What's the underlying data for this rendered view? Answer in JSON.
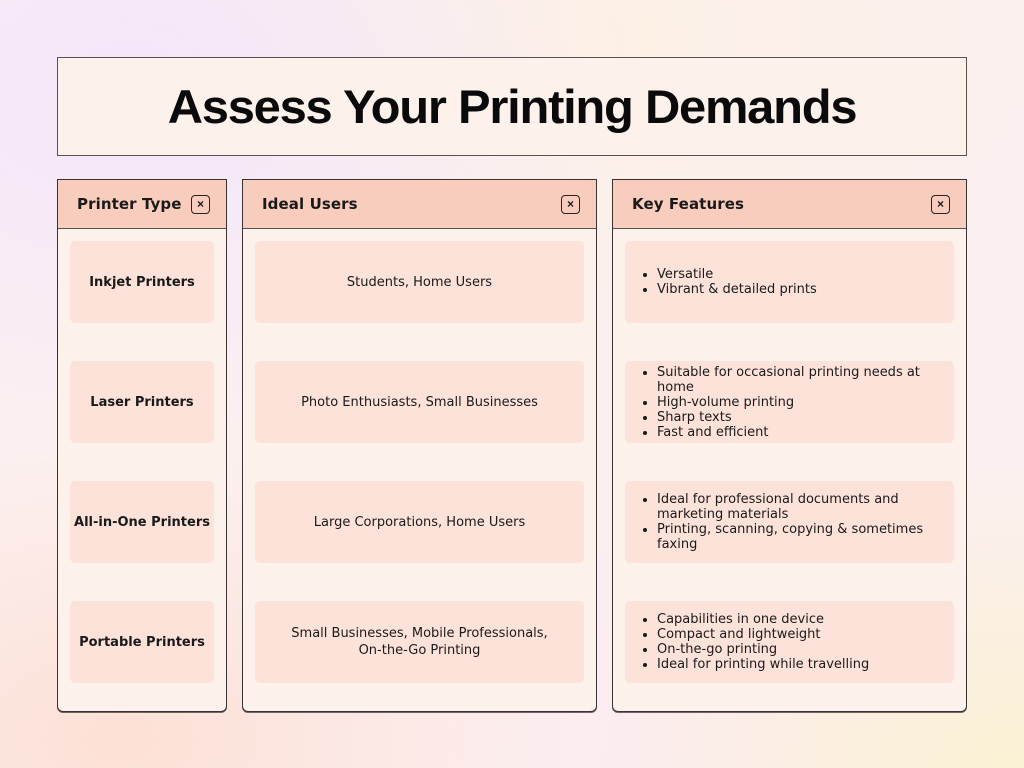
{
  "title": "Assess Your Printing Demands",
  "close_glyph": "×",
  "columns": [
    {
      "header": "Printer Type"
    },
    {
      "header": "Ideal Users"
    },
    {
      "header": "Key Features"
    }
  ],
  "rows": [
    {
      "printer_type": "Inkjet Printers",
      "ideal_users": "Students, Home Users",
      "key_features": [
        "Versatile",
        "Vibrant & detailed prints"
      ]
    },
    {
      "printer_type": "Laser Printers",
      "ideal_users": "Photo Enthusiasts, Small Businesses",
      "key_features": [
        "Suitable for occasional printing needs at home",
        "High-volume printing",
        "Sharp texts",
        "Fast and efficient"
      ]
    },
    {
      "printer_type": "All-in-One Printers",
      "ideal_users": "Large Corporations, Home Users",
      "key_features": [
        "Ideal for professional documents and marketing materials",
        "Printing, scanning, copying & sometimes faxing"
      ]
    },
    {
      "printer_type": "Portable Printers",
      "ideal_users": "Small Businesses, Mobile Professionals, On-the-Go Printing",
      "key_features": [
        "Capabilities in one device",
        "Compact and lightweight",
        "On-the-go printing",
        "Ideal for printing while travelling"
      ]
    }
  ],
  "colors": {
    "header_bg": "#f9cdbd",
    "panel_bg": "#fdf1ec",
    "cell_bg": "#fde2da",
    "border": "#3a3333"
  }
}
